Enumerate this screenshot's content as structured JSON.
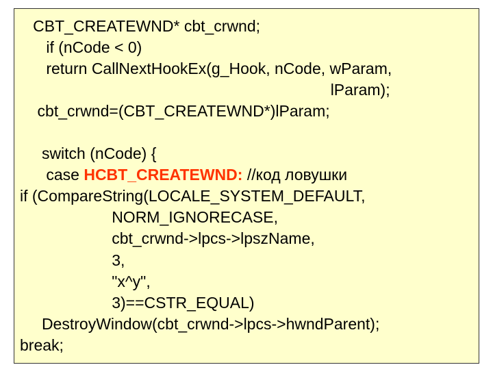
{
  "code": {
    "l1": "   CBT_CREATEWND* cbt_crwnd;",
    "l2": "      if (nCode < 0)",
    "l3": "      return CallNextHookEx(g_Hook, nCode, wParam,",
    "l4": "                                                                       lParam);",
    "l5": "    cbt_crwnd=(CBT_CREATEWND*)lParam;",
    "l6": "",
    "l7": "     switch (nCode) {",
    "l8a": "      case ",
    "l8b": "HCBT_CREATEWND:",
    "l8c": " //код ловушки",
    "l9": "if (CompareString(LOCALE_SYSTEM_DEFAULT,",
    "l10": "                     NORM_IGNORECASE,",
    "l11": "                     cbt_crwnd->lpcs->lpszName,",
    "l12": "                     3,",
    "l13": "                     \"x^y\",",
    "l14": "                     3)==CSTR_EQUAL)",
    "l15": "     DestroyWindow(cbt_crwnd->lpcs->hwndParent);",
    "l16": "break;"
  }
}
